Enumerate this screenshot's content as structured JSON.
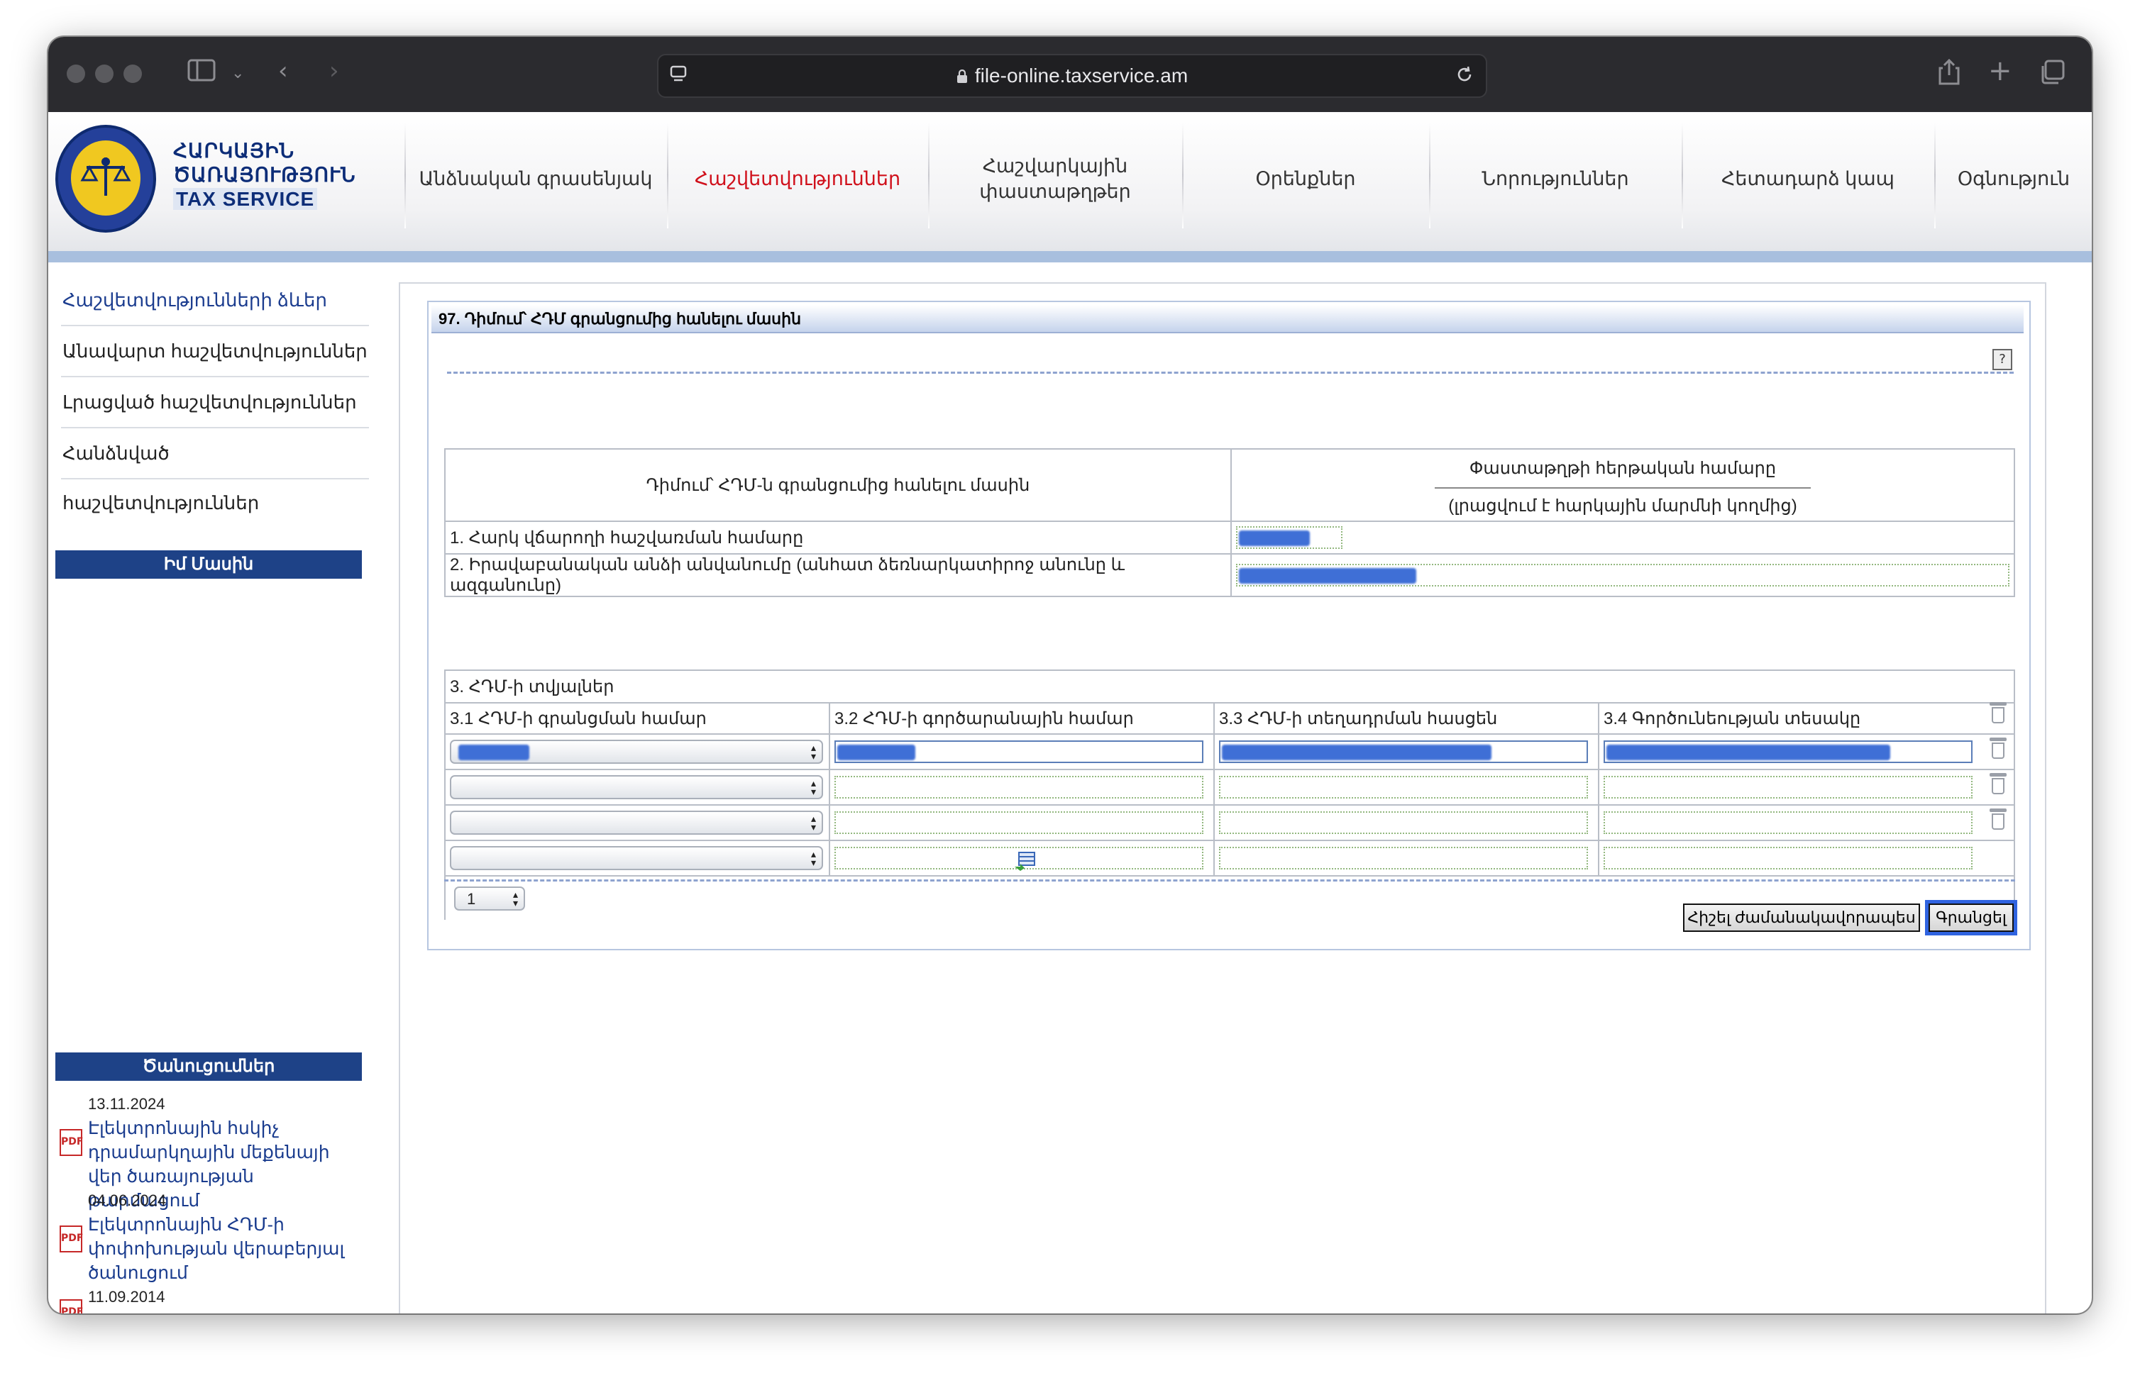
{
  "browser": {
    "url": "file-online.taxservice.am"
  },
  "logo": {
    "line1": "ՀԱՐԿԱՅԻՆ",
    "line2": "ԾԱՌԱՅՈՒԹՅՈՒՆ",
    "line3": "TAX SERVICE"
  },
  "nav": [
    {
      "label": "Անձնական գրասենյակ"
    },
    {
      "label": "Հաշվետվություններ"
    },
    {
      "label": "Հաշվարկային փաստաթղթեր"
    },
    {
      "label": "Օրենքներ"
    },
    {
      "label": "Նորություններ"
    },
    {
      "label": "Հետադարձ կապ"
    },
    {
      "label": "Օգնություն"
    }
  ],
  "sidebar": {
    "links": [
      {
        "label": "Հաշվետվությունների ձևեր"
      },
      {
        "label": "Անավարտ հաշվետվություններ"
      },
      {
        "label": "Լրացված հաշվետվություններ"
      },
      {
        "label": "Հանձնված հաշվետվություններ"
      }
    ],
    "about_title": "Իմ Մասին",
    "news_title": "Ծանուցումներ",
    "news": [
      {
        "date": "13.11.2024",
        "text": "Էլեկտրոնային հսկիչ դրամարկղային մեքենայի վեր ծառայության թարմացում"
      },
      {
        "date": "04.06.2024",
        "text": "Էլեկտրոնային ՀԴՄ-ի փոփոխության վերաբերյալ ծանուցում"
      },
      {
        "date": "11.09.2014",
        "text": ""
      }
    ]
  },
  "form": {
    "title": "97. Դիմում՝ ՀԴՄ գրանցումից հանելու մասին",
    "header_left": "Դիմում՝ ՀԴՄ-ն գրանցումից հանելու մասին",
    "header_right_title": "Փաստաթղթի հերթական համարը",
    "header_right_sub": "(լրացվում է հարկային մարմնի կողմից)",
    "row1_label": "1. Հարկ վճարողի հաշվառման համարը",
    "row2_label": "2. Իրավաբանական անձի անվանումը (անհատ ձեռնարկատիրոջ անունը և ազգանունը)",
    "section3_title": "3. ՀԴՄ-ի տվյալներ",
    "columns": [
      "3.1 ՀԴՄ-ի գրանցման համար",
      "3.2 ՀԴՄ-ի գործարանային համար",
      "3.3 ՀԴՄ-ի տեղադրման հասցեն",
      "3.4 Գործունեության տեսակը"
    ],
    "row_count_value": "1",
    "btn_save_draft": "Հիշել ժամանակավորապես",
    "btn_submit": "Գրանցել"
  }
}
